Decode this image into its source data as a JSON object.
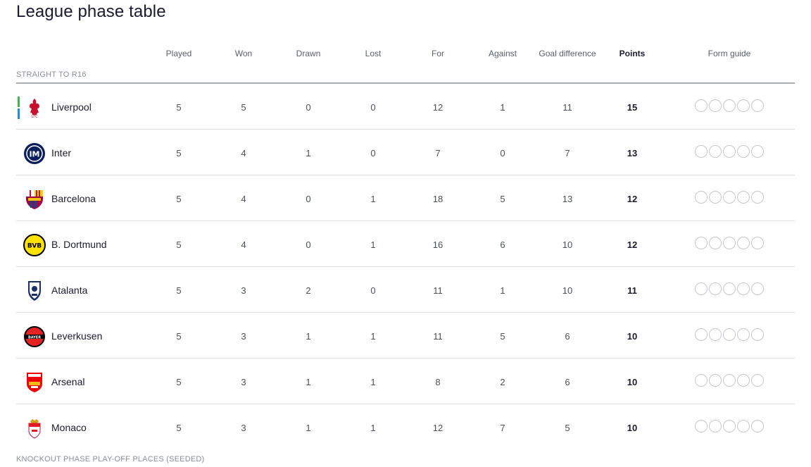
{
  "page_title": "League phase table",
  "columns": [
    "Played",
    "Won",
    "Drawn",
    "Lost",
    "For",
    "Against",
    "Goal difference",
    "Points",
    "Form guide"
  ],
  "sections": {
    "top": "STRAIGHT TO R16",
    "bottom": "KNOCKOUT PHASE PLAY-OFF PLACES (SEEDED)"
  },
  "teams": [
    {
      "name": "Liverpool",
      "crest": "liverpool-crest-icon",
      "played": "5",
      "won": "5",
      "drawn": "0",
      "lost": "0",
      "for": "12",
      "against": "1",
      "gd": "11",
      "points": "15"
    },
    {
      "name": "Inter",
      "crest": "inter-crest-icon",
      "played": "5",
      "won": "4",
      "drawn": "1",
      "lost": "0",
      "for": "7",
      "against": "0",
      "gd": "7",
      "points": "13"
    },
    {
      "name": "Barcelona",
      "crest": "barcelona-crest-icon",
      "played": "5",
      "won": "4",
      "drawn": "0",
      "lost": "1",
      "for": "18",
      "against": "5",
      "gd": "13",
      "points": "12"
    },
    {
      "name": "B. Dortmund",
      "crest": "dortmund-crest-icon",
      "played": "5",
      "won": "4",
      "drawn": "0",
      "lost": "1",
      "for": "16",
      "against": "6",
      "gd": "10",
      "points": "12"
    },
    {
      "name": "Atalanta",
      "crest": "atalanta-crest-icon",
      "played": "5",
      "won": "3",
      "drawn": "2",
      "lost": "0",
      "for": "11",
      "against": "1",
      "gd": "10",
      "points": "11"
    },
    {
      "name": "Leverkusen",
      "crest": "leverkusen-crest-icon",
      "played": "5",
      "won": "3",
      "drawn": "1",
      "lost": "1",
      "for": "11",
      "against": "5",
      "gd": "6",
      "points": "10"
    },
    {
      "name": "Arsenal",
      "crest": "arsenal-crest-icon",
      "played": "5",
      "won": "3",
      "drawn": "1",
      "lost": "1",
      "for": "8",
      "against": "2",
      "gd": "6",
      "points": "10"
    },
    {
      "name": "Monaco",
      "crest": "monaco-crest-icon",
      "played": "5",
      "won": "3",
      "drawn": "1",
      "lost": "1",
      "for": "12",
      "against": "7",
      "gd": "5",
      "points": "10"
    }
  ],
  "colors": {
    "qualify_green": "#3fb54a",
    "qualify_blue": "#1e8fd6",
    "rule": "#a9adb5"
  }
}
